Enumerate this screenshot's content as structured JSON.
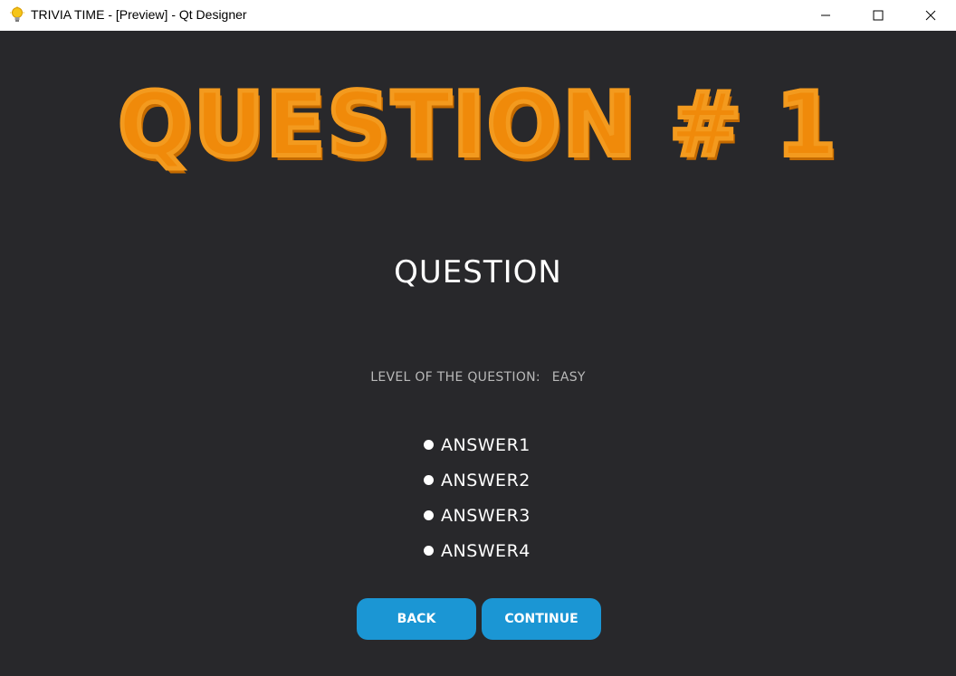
{
  "window": {
    "title": "TRIVIA TIME - [Preview] - Qt Designer",
    "icon": "lightbulb-icon",
    "controls": {
      "minimize": "minimize-icon",
      "maximize": "maximize-icon",
      "close": "close-icon"
    }
  },
  "header": {
    "title": "QUESTION # 1"
  },
  "question": {
    "text": "QUESTION"
  },
  "level": {
    "label": "LEVEL OF THE QUESTION:",
    "value": "EASY"
  },
  "answers": [
    {
      "label": "ANSWER1"
    },
    {
      "label": "ANSWER2"
    },
    {
      "label": "ANSWER3"
    },
    {
      "label": "ANSWER4"
    }
  ],
  "buttons": {
    "back": "BACK",
    "continue": "CONTINUE"
  },
  "colors": {
    "background": "#28282b",
    "title_orange": "#f08a0a",
    "button_blue": "#1b96d4",
    "text_white": "#ffffff",
    "text_gray": "#b9b9b9"
  }
}
